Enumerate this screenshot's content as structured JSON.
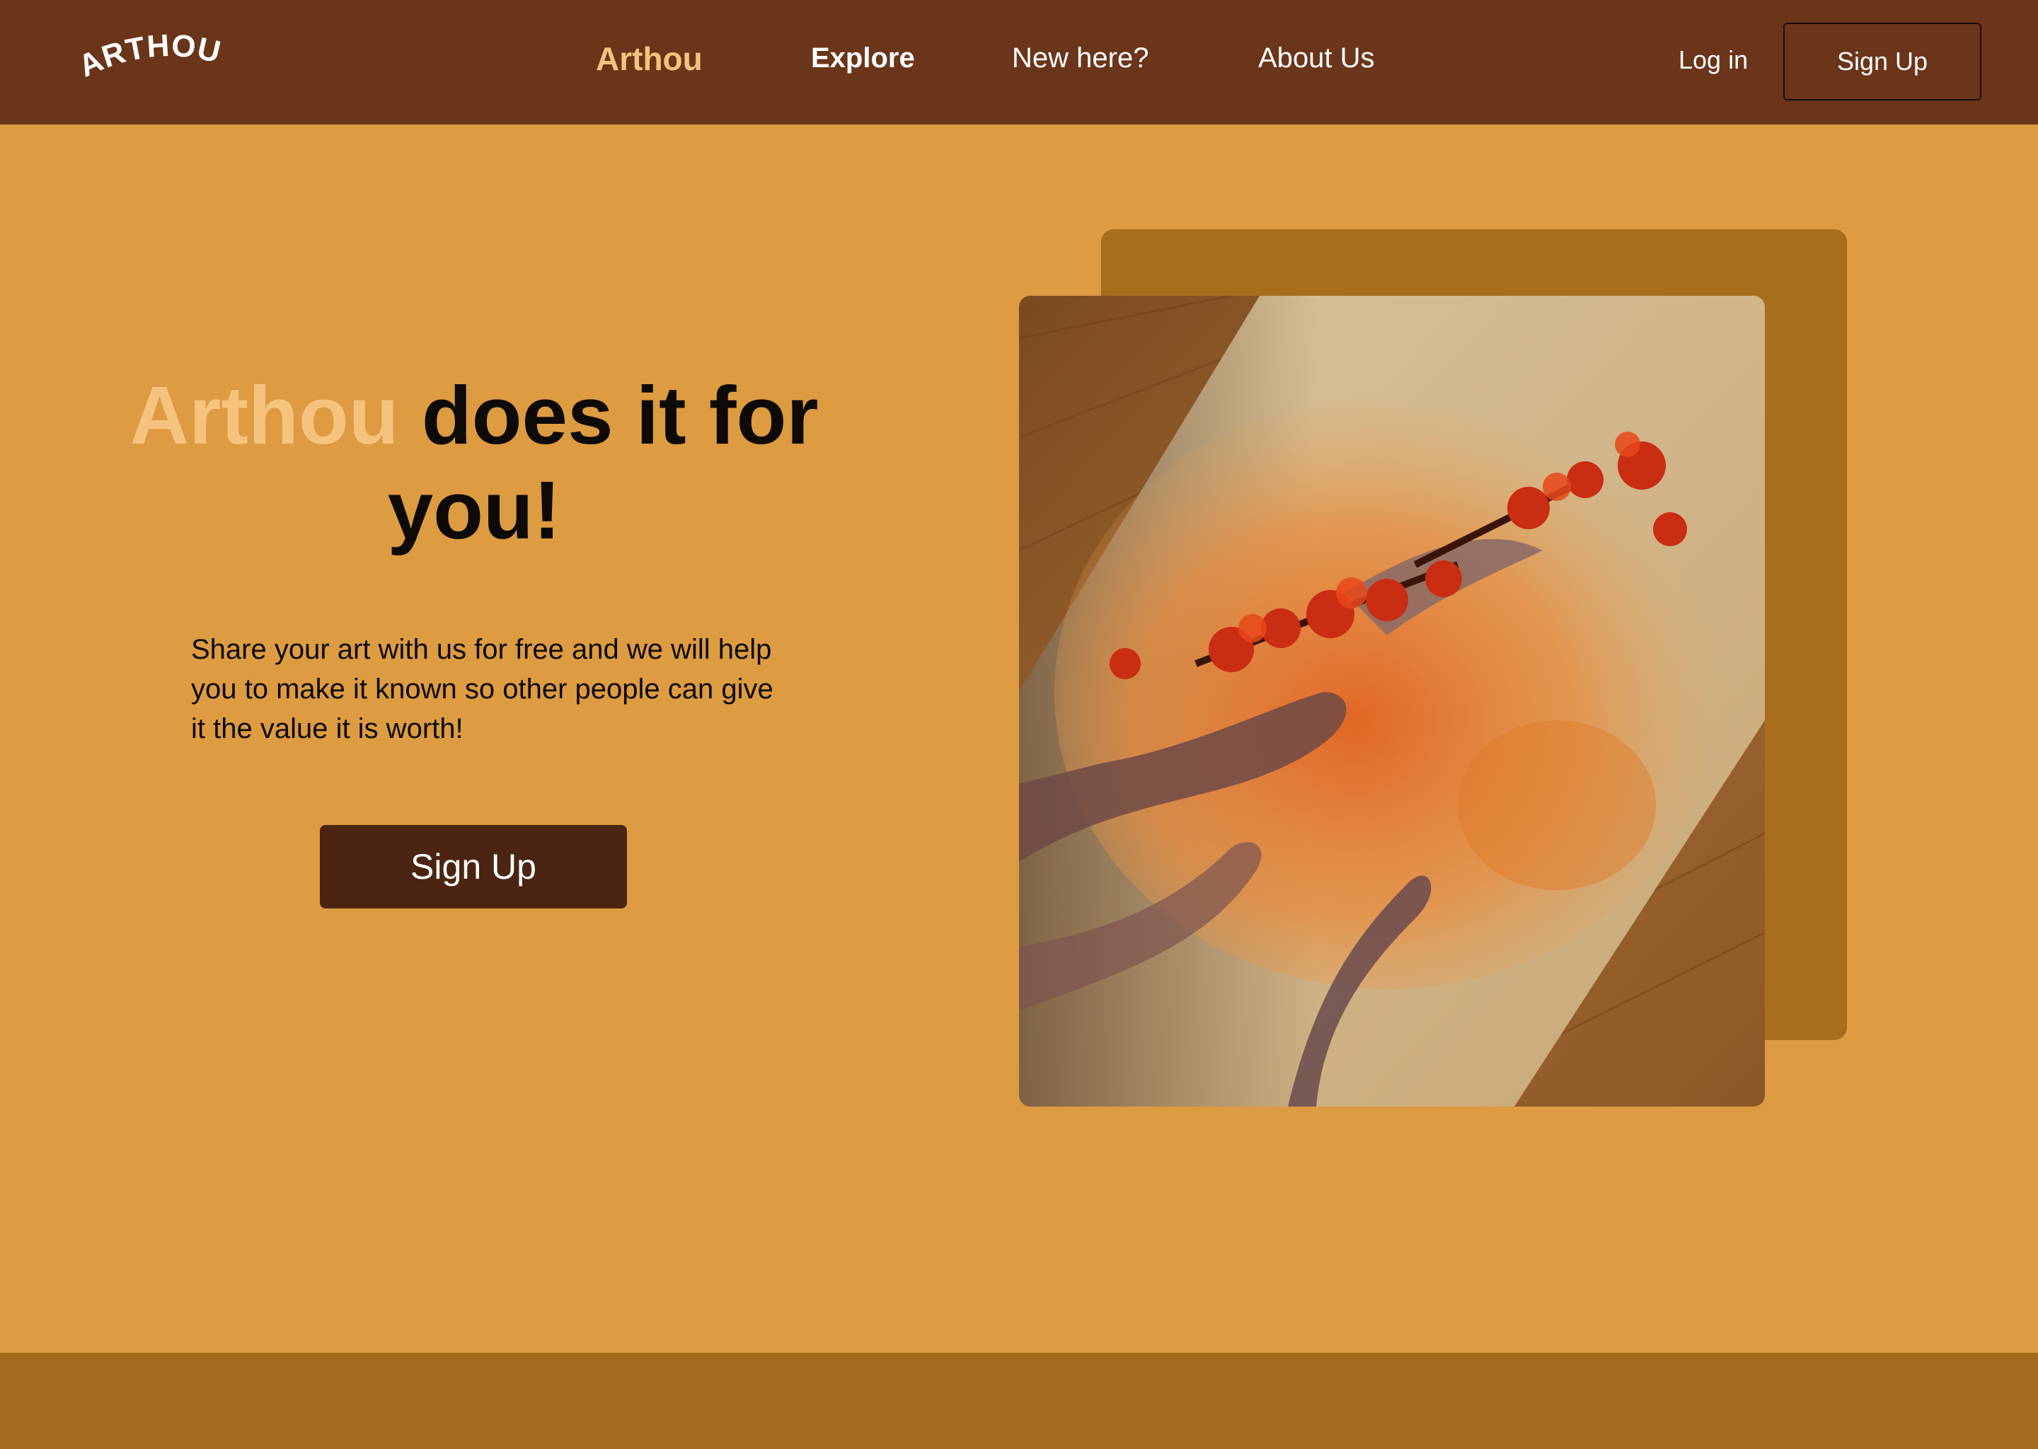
{
  "header": {
    "logo": "ARTHOU",
    "nav": {
      "brand": "Arthou",
      "explore": "Explore",
      "new_here": "New here?",
      "about": "About Us"
    },
    "login": "Log in",
    "signup": "Sign Up"
  },
  "hero": {
    "title_brand": "Arthou",
    "title_rest": " does it for you!",
    "description": "Share your art with us for free and we will help you to make it known so other people can give it the value it is worth!",
    "cta_label": "Sign Up"
  },
  "artwork": {
    "icon": "watercolor-hands-flowers-painting"
  },
  "colors": {
    "header_bg": "#6a3519",
    "page_bg": "#dd9b42",
    "accent": "#f5c37e",
    "card_bg": "#a86e1d",
    "button_bg": "#4b2512",
    "footer_bg": "#a56a1d"
  }
}
